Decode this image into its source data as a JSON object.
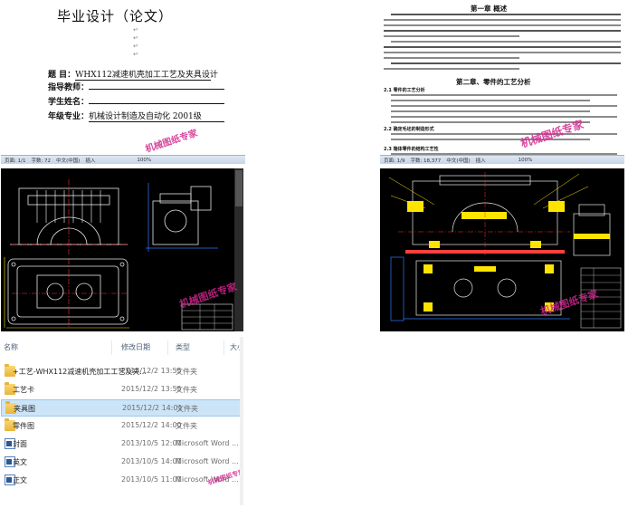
{
  "doc_cover": {
    "title": "毕业设计（论文）",
    "rows": [
      {
        "label": "题    目：",
        "value": "WHX112减速机壳加工工艺及夹具设计"
      },
      {
        "label": "指导教师：",
        "value": ""
      },
      {
        "label": "学生姓名：",
        "value": ""
      },
      {
        "label": "年级专业：",
        "value": "机械设计制造及自动化 2001级"
      }
    ],
    "status_bar": [
      "页面: 1/1",
      "字数: 72",
      "中文(中国)",
      "插入",
      "100%"
    ],
    "watermark": "机械图纸专家"
  },
  "doc_chapter": {
    "chapter1_title": "第一章 概述",
    "chapter2_title": "第二章、零件的工艺分析",
    "section_1": "2.1   零件的工艺分析",
    "section_2": "2.2   确定毛坯的制造形式",
    "section_3": "2.3   箱体零件的结构工艺性",
    "status_bar": [
      "页面: 1/9",
      "字数: 18,377",
      "中文(中国)",
      "插入",
      "100%"
    ],
    "watermark": "机械图纸专家"
  },
  "cad_left": {
    "watermark": "机械图纸专家"
  },
  "cad_right": {
    "watermark": "机械图纸专家"
  },
  "explorer": {
    "columns": {
      "name": "名称",
      "date": "修改日期",
      "type": "类型",
      "size": "大小"
    },
    "rows": [
      {
        "icon": "folder",
        "name": "+工艺-WHX112减速机壳加工工艺及夹...",
        "date": "2015/12/2 13:55",
        "type": "文件夹"
      },
      {
        "icon": "folder",
        "name": "工艺卡",
        "date": "2015/12/2 13:55",
        "type": "文件夹"
      },
      {
        "icon": "folder",
        "name": "夹具图",
        "date": "2015/12/2 14:01",
        "type": "文件夹"
      },
      {
        "icon": "folder",
        "name": "零件图",
        "date": "2015/12/2 14:00",
        "type": "文件夹"
      },
      {
        "icon": "word",
        "name": "封面",
        "date": "2013/10/5 12:01",
        "type": "Microsoft Word ..."
      },
      {
        "icon": "word",
        "name": "英文",
        "date": "2013/10/5 14:01",
        "type": "Microsoft Word ..."
      },
      {
        "icon": "word",
        "name": "正文",
        "date": "2013/10/5 11:01",
        "type": "Microsoft Word ..."
      }
    ],
    "selected_row": "夹具图",
    "watermark": "机械图纸专家"
  }
}
